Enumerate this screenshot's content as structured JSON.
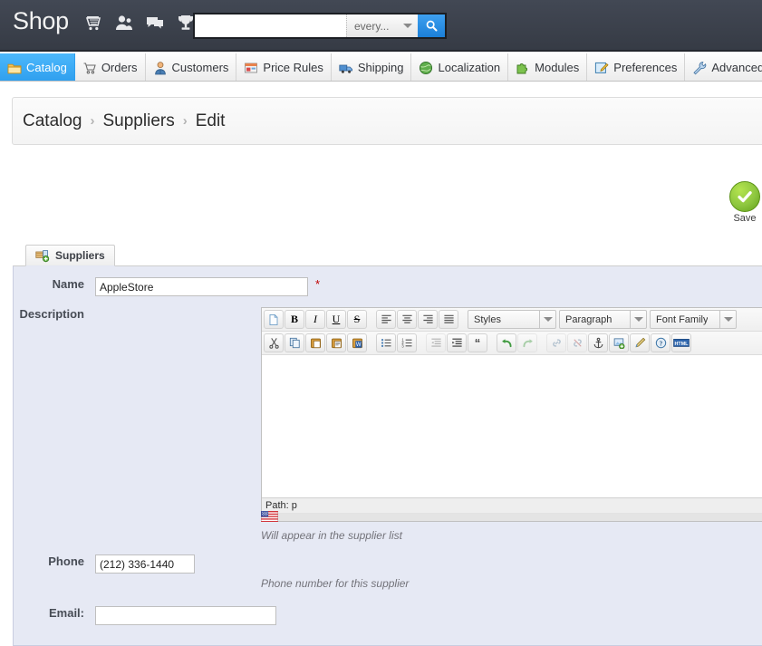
{
  "header": {
    "logo": "Shop",
    "icons": [
      {
        "name": "cart-icon",
        "label": "Orders / Cart"
      },
      {
        "name": "customers-icon",
        "label": "Customers"
      },
      {
        "name": "messages-icon",
        "label": "Messages"
      },
      {
        "name": "trophy-icon",
        "label": "Best sellers"
      }
    ],
    "search": {
      "value": "",
      "placeholder": "",
      "scope_label": "every...",
      "button_icon": "search-icon"
    }
  },
  "nav": {
    "items": [
      {
        "label": "Catalog",
        "icon": "folder-icon",
        "active": true
      },
      {
        "label": "Orders",
        "icon": "cart-icon",
        "active": false
      },
      {
        "label": "Customers",
        "icon": "customer-icon",
        "active": false
      },
      {
        "label": "Price Rules",
        "icon": "pricetag-icon",
        "active": false
      },
      {
        "label": "Shipping",
        "icon": "truck-icon",
        "active": false
      },
      {
        "label": "Localization",
        "icon": "globe-icon",
        "active": false
      },
      {
        "label": "Modules",
        "icon": "puzzle-icon",
        "active": false
      },
      {
        "label": "Preferences",
        "icon": "prefs-icon",
        "active": false
      },
      {
        "label": "Advanced Parameters",
        "icon": "wrench-icon",
        "active": false
      },
      {
        "label": "",
        "icon": "more-icon",
        "active": false
      }
    ]
  },
  "breadcrumb": {
    "items": [
      "Catalog",
      "Suppliers",
      "Edit"
    ],
    "separator": "›"
  },
  "save": {
    "label": "Save",
    "icon": "check-icon"
  },
  "panel": {
    "tab_label": "Suppliers",
    "tab_icon": "suppliers-icon"
  },
  "form": {
    "name": {
      "label": "Name",
      "value": "AppleStore",
      "placeholder": "",
      "required_marker": "*"
    },
    "description": {
      "label": "Description",
      "hint": "Will appear in the supplier list",
      "flag_icon": "us-flag-icon",
      "editor": {
        "status_path": "Path: p",
        "content": "",
        "selects": [
          {
            "name": "styles-select",
            "label": "Styles"
          },
          {
            "name": "paragraph-select",
            "label": "Paragraph"
          },
          {
            "name": "fontfamily-select",
            "label": "Font Family"
          }
        ],
        "row1_buttons": [
          "newdocument-icon",
          "bold-icon",
          "italic-icon",
          "underline-icon",
          "strikethrough-icon",
          "align-left-icon",
          "align-center-icon",
          "align-right-icon",
          "align-justify-icon"
        ],
        "row2_buttons": [
          "cut-icon",
          "copy-icon",
          "paste-icon",
          "paste-text-icon",
          "paste-word-icon",
          "bullist-icon",
          "numlist-icon",
          "outdent-icon",
          "indent-icon",
          "blockquote-icon",
          "undo-icon",
          "redo-icon",
          "link-icon",
          "unlink-icon",
          "anchor-icon",
          "image-icon",
          "cleanup-icon",
          "help-icon",
          "html-icon"
        ]
      }
    },
    "phone": {
      "label": "Phone",
      "value": "(212) 336-1440",
      "placeholder": "",
      "hint": "Phone number for this supplier"
    },
    "email": {
      "label": "Email:",
      "value": "",
      "placeholder": ""
    }
  },
  "colors": {
    "header_bg": "#3b414c",
    "nav_active": "#2f9fee",
    "panel_bg": "#e6e9f4",
    "save_green": "#8dc63f",
    "required_red": "#c00000"
  }
}
